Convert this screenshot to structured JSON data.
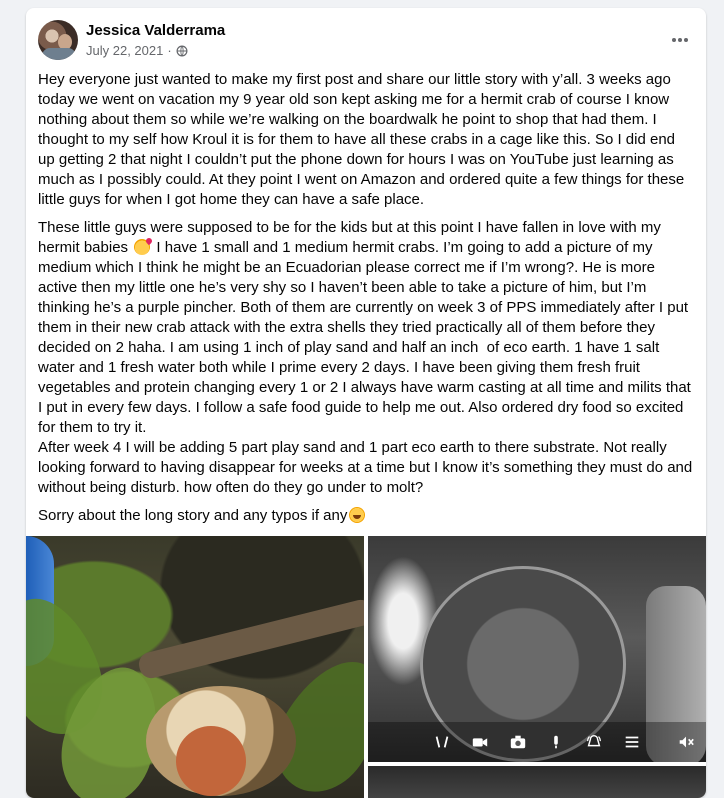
{
  "post": {
    "author": "Jessica Valderrama",
    "date": "July 22, 2021",
    "separator": "·",
    "privacy_icon": "globe-icon",
    "more_icon": "more-horizontal-icon",
    "paragraphs": [
      "Hey everyone just wanted to make my first post and share our little story with y’all. 3 weeks ago today we went on vacation my 9 year old son kept asking me for a hermit crab of course I know nothing about them so while we’re walking on the boardwalk he point to shop that had them. I thought to my self how Kroul it is for them to have all these crabs in a cage like this. So I did end up getting 2 that night I couldn’t put the phone down for hours I was on YouTube just learning as much as I possibly could. At they point I went on Amazon and ordered quite a few things for these little guys for when I got home they can have a safe place.",
      {
        "before_emoji": "These little guys were supposed to be for the kids but at this point I have fallen in love with my hermit babies ",
        "emoji": "smiling-face-with-hearts",
        "after_emoji": " I have 1 small and 1 medium hermit crabs. I’m going to add a picture of my medium which I think he might be an Ecuadorian please correct me if I’m wrong?. He is more active then my little one he’s very shy so I haven’t been able to take a picture of him, but I’m thinking he’s a purple pincher. Both of them are currently on week 3 of PPS immediately after I put them in their new crab attack with the extra shells they tried practically all of them before they decided on 2 haha. I am using 1 inch of play sand and half an inch  of eco earth. 1 have 1 salt water and 1 fresh water both while I prime every 2 days. I have been giving them fresh fruit vegetables and protein changing every 1 or 2 I always have warm casting at all time and milits that I put in every few days. I follow a safe food guide to help me out. Also ordered dry food so excited for them to try it.\nAfter week 4 I will be adding 5 part play sand and 1 part eco earth to there substrate. Not really looking forward to having disappear for weeks at a time but I know it’s something they must do and without being disturb. how often do they go under to molt?"
      },
      {
        "before_emoji": "Sorry about the long story and any typos if any",
        "emoji": "rolling-on-the-floor-laughing"
      }
    ]
  },
  "photos": [
    {
      "subject": "hermit-crab-on-branch"
    },
    {
      "subject": "crabitat-night-camera",
      "controls": [
        "mic-icon",
        "video-icon",
        "camera-icon",
        "microphone-icon",
        "alarm-icon",
        "menu-icon",
        "volume-mute-icon"
      ]
    },
    {
      "subject": "additional-photo"
    }
  ],
  "colors": {
    "background": "#f0f2f5",
    "card": "#ffffff",
    "text_primary": "#050505",
    "text_secondary": "#65676b"
  }
}
